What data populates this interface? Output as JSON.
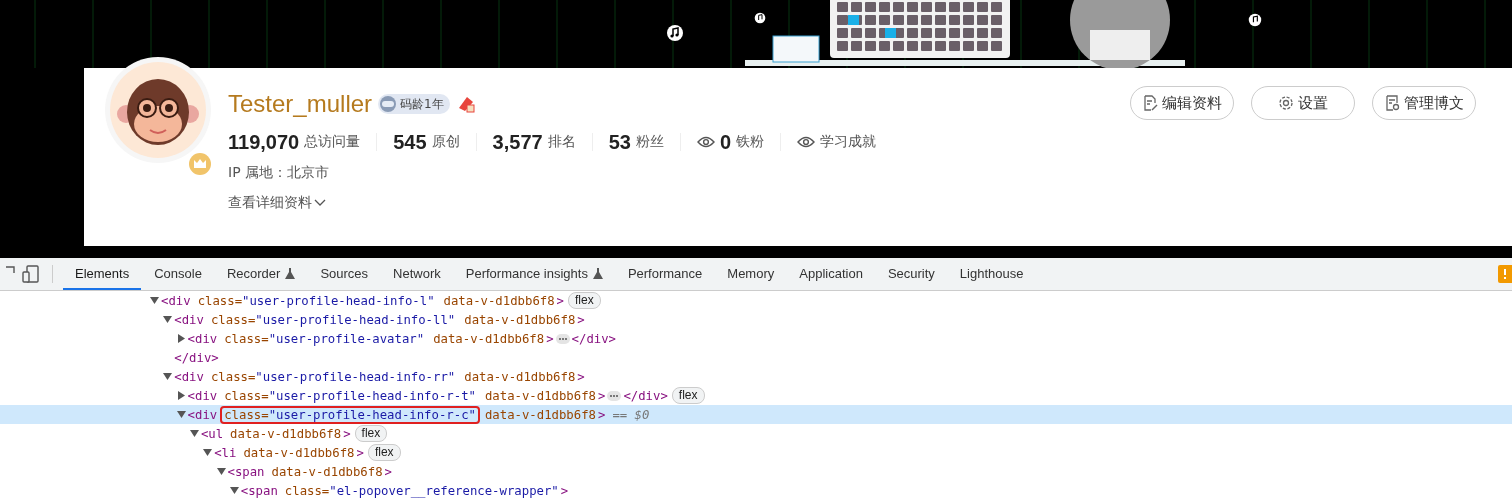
{
  "profile": {
    "name": "Tester_muller",
    "badge": "码龄1年",
    "stats": [
      {
        "kind": "count",
        "value": "119,070",
        "label": "总访问量"
      },
      {
        "kind": "count",
        "value": "545",
        "label": "原创"
      },
      {
        "kind": "count",
        "value": "3,577",
        "label": "排名"
      },
      {
        "kind": "count",
        "value": "53",
        "label": "粉丝"
      },
      {
        "kind": "eye",
        "value": "0",
        "label": "铁粉"
      },
      {
        "kind": "eye",
        "label": "学习成就"
      }
    ],
    "location": "IP 属地：北京市",
    "details_link": "查看详细资料",
    "actions": [
      {
        "kind": "edit",
        "label": "编辑资料"
      },
      {
        "kind": "settings",
        "label": "设置"
      },
      {
        "kind": "manage",
        "label": "管理博文"
      }
    ]
  },
  "devtools": {
    "tabs": [
      {
        "label": "Elements",
        "selected": true,
        "experimental": false
      },
      {
        "label": "Console",
        "selected": false,
        "experimental": false
      },
      {
        "label": "Recorder",
        "selected": false,
        "experimental": true
      },
      {
        "label": "Sources",
        "selected": false,
        "experimental": false
      },
      {
        "label": "Network",
        "selected": false,
        "experimental": false
      },
      {
        "label": "Performance insights",
        "selected": false,
        "experimental": true
      },
      {
        "label": "Performance",
        "selected": false,
        "experimental": false
      },
      {
        "label": "Memory",
        "selected": false,
        "experimental": false
      },
      {
        "label": "Application",
        "selected": false,
        "experimental": false
      },
      {
        "label": "Security",
        "selected": false,
        "experimental": false
      },
      {
        "label": "Lighthouse",
        "selected": false,
        "experimental": false
      }
    ],
    "dom_tree": [
      {
        "tag": "<div",
        "attributes": [
          {
            "name": "class=",
            "value": "\"user-profile-head-info-l\"",
            "highlighted": false
          },
          {
            "name": "data-v-d1dbb6f8",
            "highlighted": false
          }
        ],
        "tag_end": ">",
        "badge": "flex",
        "expanded": true,
        "selected": false,
        "children": [
          {
            "tag": "<div",
            "attributes": [
              {
                "name": "class=",
                "value": "\"user-profile-head-info-ll\"",
                "highlighted": false
              },
              {
                "name": "data-v-d1dbb6f8",
                "highlighted": false
              }
            ],
            "tag_end": ">",
            "expanded": true,
            "selected": false,
            "closing": "</div>",
            "children": [
              {
                "tag": "<div",
                "attributes": [
                  {
                    "name": "class=",
                    "value": "\"user-profile-avatar\"",
                    "highlighted": false
                  },
                  {
                    "name": "data-v-d1dbb6f8",
                    "highlighted": false
                  }
                ],
                "tag_end": ">",
                "expanded": false,
                "selected": false,
                "closing": "</div>"
              }
            ]
          },
          {
            "tag": "<div",
            "attributes": [
              {
                "name": "class=",
                "value": "\"user-profile-head-info-rr\"",
                "highlighted": false
              },
              {
                "name": "data-v-d1dbb6f8",
                "highlighted": false
              }
            ],
            "tag_end": ">",
            "expanded": true,
            "selected": false,
            "children": [
              {
                "tag": "<div",
                "attributes": [
                  {
                    "name": "class=",
                    "value": "\"user-profile-head-info-r-t\"",
                    "highlighted": false
                  },
                  {
                    "name": "data-v-d1dbb6f8",
                    "highlighted": false
                  }
                ],
                "tag_end": ">",
                "badge": "flex",
                "expanded": false,
                "selected": false,
                "closing": "</div>"
              },
              {
                "tag": "<div",
                "attributes": [
                  {
                    "name": "class=",
                    "value": "\"user-profile-head-info-r-c\"",
                    "highlighted": true
                  },
                  {
                    "name": "data-v-d1dbb6f8",
                    "highlighted": false
                  }
                ],
                "tag_end": ">",
                "console_ref": "== $0",
                "expanded": true,
                "selected": true,
                "children": [
                  {
                    "tag": "<ul",
                    "attributes": [
                      {
                        "name": "data-v-d1dbb6f8",
                        "highlighted": false
                      }
                    ],
                    "tag_end": ">",
                    "badge": "flex",
                    "expanded": true,
                    "selected": false,
                    "children": [
                      {
                        "tag": "<li",
                        "attributes": [
                          {
                            "name": "data-v-d1dbb6f8",
                            "highlighted": false
                          }
                        ],
                        "tag_end": ">",
                        "badge": "flex",
                        "expanded": true,
                        "selected": false,
                        "children": [
                          {
                            "tag": "<span",
                            "attributes": [
                              {
                                "name": "data-v-d1dbb6f8",
                                "highlighted": false
                              }
                            ],
                            "tag_end": ">",
                            "expanded": true,
                            "selected": false,
                            "children": [
                              {
                                "tag": "<span",
                                "attributes": [
                                  {
                                    "name": "class=",
                                    "value": "\"el-popover__reference-wrapper\"",
                                    "highlighted": false
                                  }
                                ],
                                "tag_end": ">",
                                "expanded": true,
                                "selected": false
                              }
                            ]
                          }
                        ]
                      }
                    ]
                  }
                ]
              }
            ]
          }
        ]
      }
    ]
  }
}
